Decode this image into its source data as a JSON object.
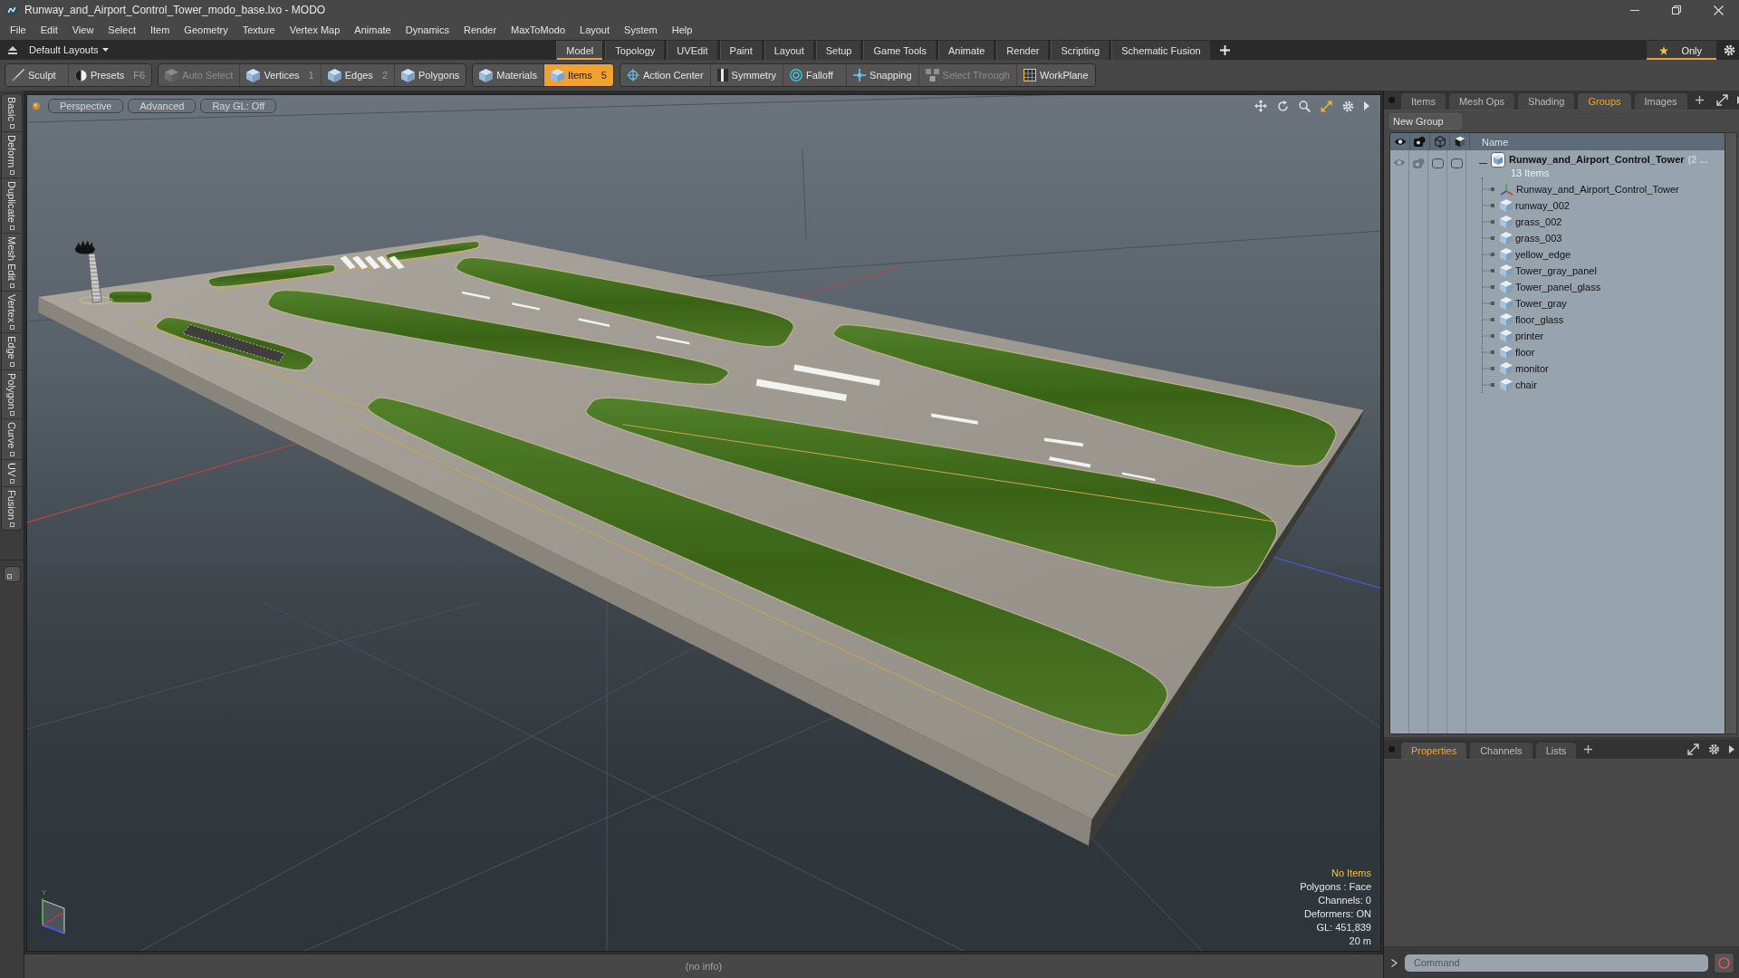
{
  "window": {
    "title": "Runway_and_Airport_Control_Tower_modo_base.lxo - MODO"
  },
  "menu": [
    "File",
    "Edit",
    "View",
    "Select",
    "Item",
    "Geometry",
    "Texture",
    "Vertex Map",
    "Animate",
    "Dynamics",
    "Render",
    "MaxToModo",
    "Layout",
    "System",
    "Help"
  ],
  "layout_bar": {
    "layout_menu": "Default Layouts",
    "tabs": [
      {
        "label": "Model",
        "selected": true
      },
      {
        "label": "Topology",
        "selected": false
      },
      {
        "label": "UVEdit",
        "selected": false
      },
      {
        "label": "Paint",
        "selected": false
      },
      {
        "label": "Layout",
        "selected": false
      },
      {
        "label": "Setup",
        "selected": false
      },
      {
        "label": "Game Tools",
        "selected": false
      },
      {
        "label": "Animate",
        "selected": false
      },
      {
        "label": "Render",
        "selected": false
      },
      {
        "label": "Scripting",
        "selected": false
      },
      {
        "label": "Schematic Fusion",
        "selected": false
      }
    ],
    "only_button": {
      "label": "Only",
      "on": true
    }
  },
  "toolbar": [
    {
      "tools": [
        {
          "label": "Sculpt",
          "disabled": false,
          "selected": false
        },
        {
          "label": "Presets",
          "shortcut": "F6",
          "disabled": false,
          "selected": false
        }
      ]
    },
    {
      "tools": [
        {
          "label": "Auto Select",
          "disabled": true,
          "selected": false
        },
        {
          "label": "Vertices",
          "shortcut": "1",
          "disabled": false,
          "selected": false
        },
        {
          "label": "Edges",
          "shortcut": "2",
          "disabled": false,
          "selected": false
        },
        {
          "label": "Polygons",
          "disabled": false,
          "selected": false
        }
      ]
    },
    {
      "tools": [
        {
          "label": "Materials",
          "disabled": false,
          "selected": false
        },
        {
          "label": "Items",
          "shortcut": "5",
          "disabled": false,
          "selected": true
        }
      ]
    },
    {
      "tools": [
        {
          "label": "Action Center",
          "disabled": false,
          "selected": false
        },
        {
          "label": "Symmetry",
          "disabled": false,
          "selected": false
        },
        {
          "label": "Falloff",
          "disabled": false,
          "selected": false
        },
        {
          "label": "Snapping",
          "disabled": false,
          "selected": false
        },
        {
          "label": "Select Through",
          "disabled": true,
          "selected": false
        },
        {
          "label": "WorkPlane",
          "disabled": false,
          "selected": false
        }
      ]
    }
  ],
  "side_tabs": [
    "Basic",
    "Deform",
    "Duplicate",
    "Mesh Edit",
    "Vertex",
    "Edge",
    "Polygon",
    "Curve",
    "UV",
    "Fusion"
  ],
  "viewport": {
    "buttons": [
      "Perspective",
      "Advanced",
      "Ray GL: Off"
    ],
    "gizmo_label": "Y",
    "info": [
      {
        "text": "No Items",
        "kind": "highlight"
      },
      {
        "text": "Polygons : Face",
        "kind": "plain"
      },
      {
        "text": "Channels: 0",
        "kind": "plain"
      },
      {
        "text": "Deformers: ON",
        "kind": "plain"
      },
      {
        "text": "GL: 451,839",
        "kind": "plain"
      },
      {
        "text": "20 m",
        "kind": "plain"
      }
    ]
  },
  "status_bar": {
    "text": "(no info)"
  },
  "items_panel": {
    "tabs": [
      {
        "label": "Items",
        "selected": false
      },
      {
        "label": "Mesh Ops",
        "selected": false
      },
      {
        "label": "Shading",
        "selected": false
      },
      {
        "label": "Groups",
        "selected": true
      },
      {
        "label": "Images",
        "selected": false
      }
    ],
    "new_group_button": "New Group",
    "name_column": "Name",
    "tree": {
      "name": "Runway_and_Airport_Control_Tower",
      "suffix": "(2 ...",
      "count": "13 Items",
      "expanded": true,
      "children": [
        {
          "name": "Runway_and_Airport_Control_Tower",
          "kind": "locator"
        },
        {
          "name": "runway_002",
          "kind": "mesh"
        },
        {
          "name": "grass_002",
          "kind": "mesh"
        },
        {
          "name": "grass_003",
          "kind": "mesh"
        },
        {
          "name": "yellow_edge",
          "kind": "mesh"
        },
        {
          "name": "Tower_gray_panel",
          "kind": "mesh"
        },
        {
          "name": "Tower_panel_glass",
          "kind": "mesh"
        },
        {
          "name": "Tower_gray",
          "kind": "mesh"
        },
        {
          "name": "floor_glass",
          "kind": "mesh"
        },
        {
          "name": "printer",
          "kind": "mesh"
        },
        {
          "name": "floor",
          "kind": "mesh"
        },
        {
          "name": "monitor",
          "kind": "mesh"
        },
        {
          "name": "chair",
          "kind": "mesh"
        }
      ]
    }
  },
  "properties_panel": {
    "tabs": [
      {
        "label": "Properties",
        "selected": true
      },
      {
        "label": "Channels",
        "selected": false
      },
      {
        "label": "Lists",
        "selected": false
      }
    ]
  },
  "command": {
    "placeholder": "Command"
  }
}
